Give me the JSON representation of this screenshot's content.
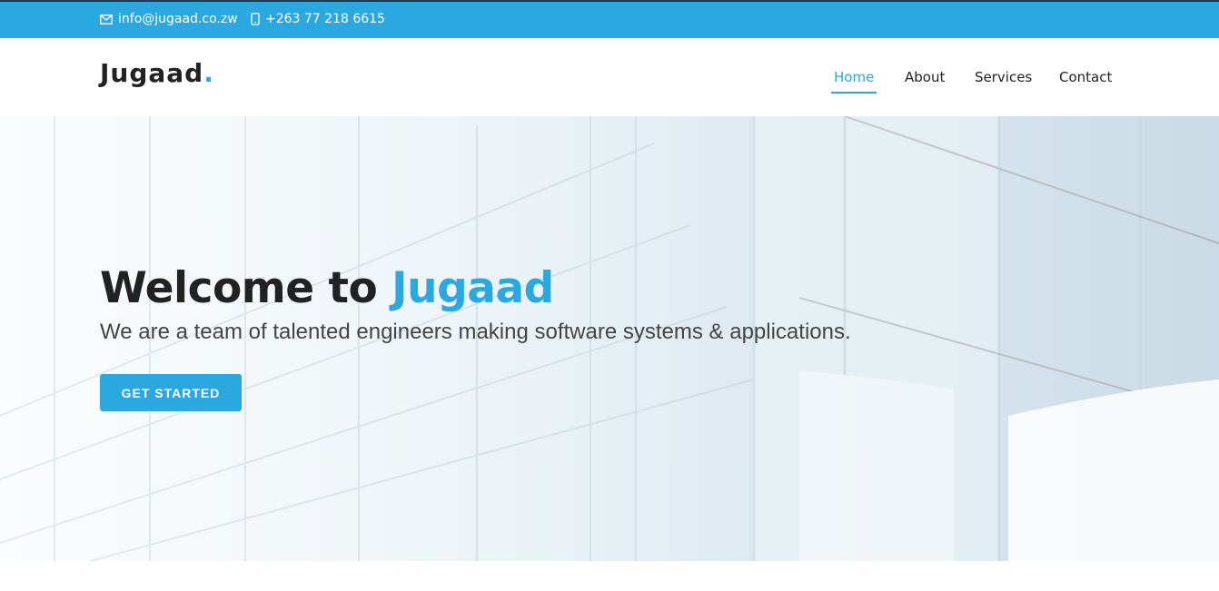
{
  "topbar": {
    "email": "info@jugaad.co.zw",
    "email_icon": "envelope-icon",
    "phone": "+263 77 218 6615",
    "phone_icon": "mobile-phone-icon"
  },
  "header": {
    "logo_text": "Jugaad",
    "logo_dot": "."
  },
  "nav": {
    "items": [
      {
        "label": "Home",
        "active": true
      },
      {
        "label": "About",
        "active": false
      },
      {
        "label": "Services",
        "active": false
      },
      {
        "label": "Contact",
        "active": false
      }
    ]
  },
  "hero": {
    "title_prefix": "Welcome to ",
    "title_brand": "Jugaad",
    "subtitle": "We are a team of talented engineers making software systems & applications.",
    "cta_label": "GET STARTED",
    "background": "glass-building-facade"
  },
  "colors": {
    "accent": "#2ba8e0",
    "text_dark": "#222222",
    "text_muted": "#444444"
  }
}
